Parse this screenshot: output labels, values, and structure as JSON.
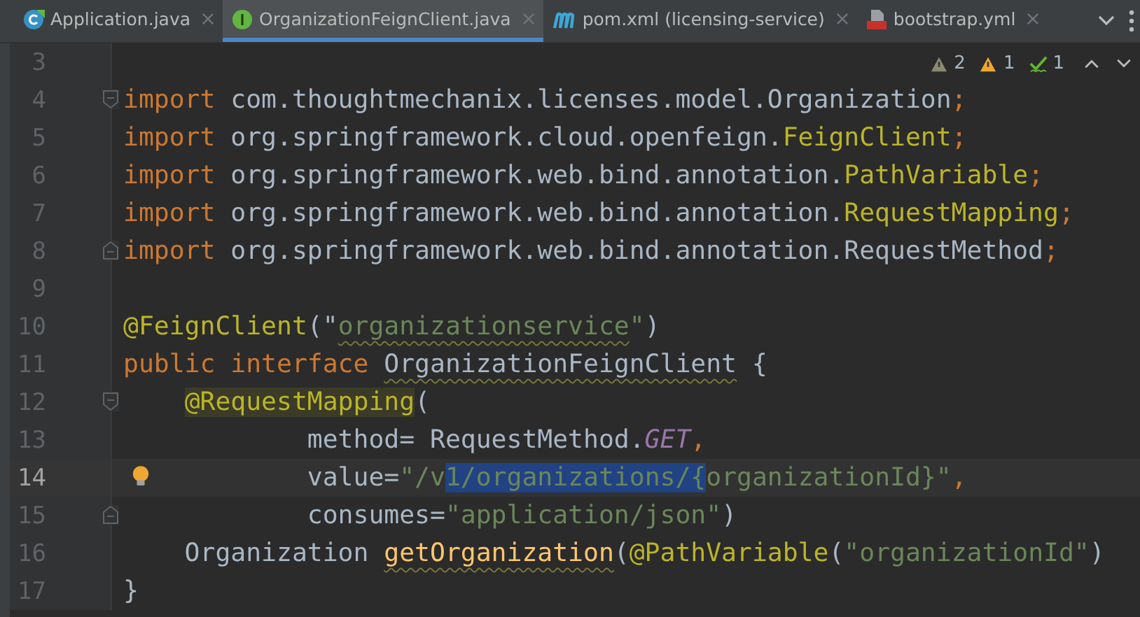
{
  "tabs": [
    {
      "label": "Application.java",
      "selected": false
    },
    {
      "label": "OrganizationFeignClient.java",
      "selected": true
    },
    {
      "label": "pom.xml (licensing-service)",
      "selected": false
    },
    {
      "label": "bootstrap.yml",
      "selected": false
    }
  ],
  "inspections": [
    {
      "kind": "weak",
      "count": "2"
    },
    {
      "kind": "warning",
      "count": "1"
    },
    {
      "kind": "typo",
      "count": "1"
    }
  ],
  "lines": [
    {
      "number": "3",
      "current": false
    },
    {
      "number": "4",
      "current": false,
      "fold_start": true,
      "tokens": [
        {
          "kind": "kw",
          "text": "import"
        },
        {
          "kind": "plain",
          "text": " com.thoughtmechanix.licenses.model.Organization"
        },
        {
          "kind": "punc",
          "text": ";"
        }
      ]
    },
    {
      "number": "5",
      "current": false,
      "tokens": [
        {
          "kind": "kw",
          "text": "import"
        },
        {
          "kind": "plain",
          "text": " org.springframework.cloud.openfeign."
        },
        {
          "kind": "cls",
          "text": "FeignClient"
        },
        {
          "kind": "punc",
          "text": ";"
        }
      ]
    },
    {
      "number": "6",
      "current": false,
      "tokens": [
        {
          "kind": "kw",
          "text": "import"
        },
        {
          "kind": "plain",
          "text": " org.springframework.web.bind.annotation."
        },
        {
          "kind": "cls",
          "text": "PathVariable"
        },
        {
          "kind": "punc",
          "text": ";"
        }
      ]
    },
    {
      "number": "7",
      "current": false,
      "tokens": [
        {
          "kind": "kw",
          "text": "import"
        },
        {
          "kind": "plain",
          "text": " org.springframework.web.bind.annotation."
        },
        {
          "kind": "cls",
          "text": "RequestMapping"
        },
        {
          "kind": "punc",
          "text": ";"
        }
      ]
    },
    {
      "number": "8",
      "current": false,
      "fold_end": true,
      "tokens": [
        {
          "kind": "kw",
          "text": "import"
        },
        {
          "kind": "plain",
          "text": " org.springframework.web.bind.annotation.RequestMethod"
        },
        {
          "kind": "punc",
          "text": ";"
        }
      ]
    },
    {
      "number": "9",
      "current": false
    },
    {
      "number": "10",
      "current": false,
      "tokens": [
        {
          "kind": "ann",
          "text": "@FeignClient"
        },
        {
          "kind": "plain",
          "text": "(\""
        },
        {
          "kind": "str_warn",
          "text": "organizationservice"
        },
        {
          "kind": "str",
          "text": "\""
        },
        {
          "kind": "plain",
          "text": ")"
        }
      ]
    },
    {
      "number": "11",
      "current": false,
      "tokens": [
        {
          "kind": "kw",
          "text": "public interface "
        },
        {
          "kind": "plain_warn",
          "text": "OrganizationFeignClient"
        },
        {
          "kind": "plain",
          "text": " {"
        }
      ]
    },
    {
      "number": "12",
      "current": false,
      "fold_start": true,
      "tokens": [
        {
          "kind": "ann_hl",
          "text": "    @RequestMapping"
        },
        {
          "kind": "plain",
          "text": "("
        }
      ]
    },
    {
      "number": "13",
      "current": false,
      "tokens": [
        {
          "kind": "plain",
          "text": "            method= RequestMethod."
        },
        {
          "kind": "const",
          "text": "GET"
        },
        {
          "kind": "punc",
          "text": ","
        }
      ]
    },
    {
      "number": "14",
      "current": true,
      "bulb": true,
      "tokens": [
        {
          "kind": "plain",
          "text": "            value="
        },
        {
          "kind": "str",
          "text": "\"/v"
        },
        {
          "kind": "sel",
          "text": "1/organizations/{"
        },
        {
          "kind": "str",
          "text": "organizationId}\""
        },
        {
          "kind": "punc",
          "text": ","
        }
      ]
    },
    {
      "number": "15",
      "current": false,
      "fold_end": true,
      "tokens": [
        {
          "kind": "plain",
          "text": "            consumes="
        },
        {
          "kind": "str",
          "text": "\"application/json\""
        },
        {
          "kind": "plain",
          "text": ")"
        }
      ]
    },
    {
      "number": "16",
      "current": false,
      "tokens": [
        {
          "kind": "plain",
          "text": "    Organization "
        },
        {
          "kind": "method_warn",
          "text": "getOrganization"
        },
        {
          "kind": "plain",
          "text": "("
        },
        {
          "kind": "ann",
          "text": "@PathVariable"
        },
        {
          "kind": "plain",
          "text": "("
        },
        {
          "kind": "str",
          "text": "\"organizationId\""
        },
        {
          "kind": "plain",
          "text": ")"
        }
      ]
    },
    {
      "number": "17",
      "current": false,
      "tokens": [
        {
          "kind": "plain",
          "text": "}"
        }
      ]
    }
  ]
}
